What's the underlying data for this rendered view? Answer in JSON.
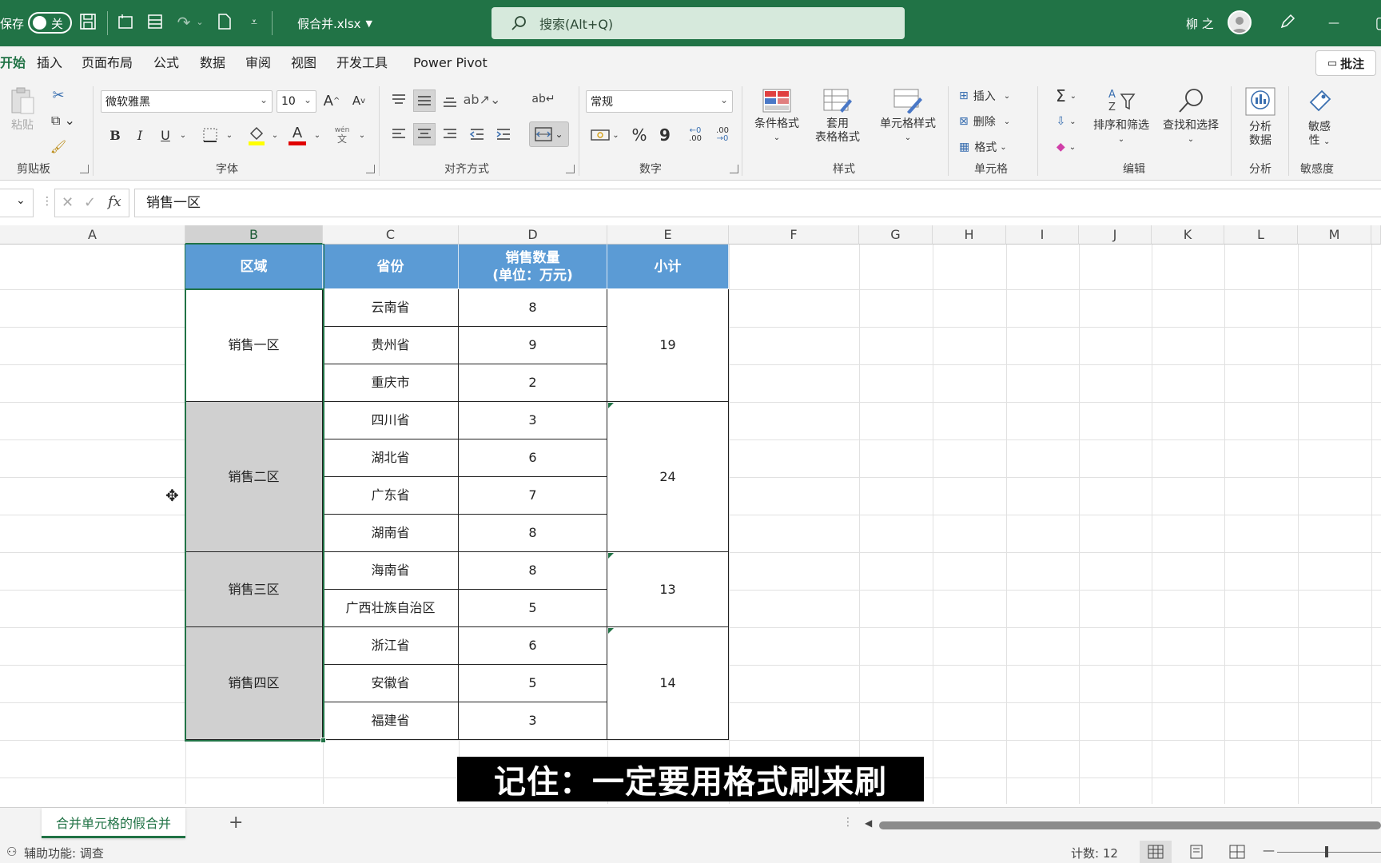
{
  "titlebar": {
    "autosave_label": "保存",
    "autosave_state": "关",
    "filename": "假合并.xlsx",
    "search_placeholder": "搜索(Alt+Q)",
    "user_name": "柳 之",
    "minimize_glyph": "—",
    "background_color": "#217346"
  },
  "menu": {
    "tabs": [
      "开始",
      "插入",
      "页面布局",
      "公式",
      "数据",
      "审阅",
      "视图",
      "开发工具",
      "Power Pivot"
    ],
    "active_tab": "开始",
    "comment_button": "批注"
  },
  "ribbon": {
    "clipboard": {
      "paste": "粘贴",
      "group": "剪贴板"
    },
    "font": {
      "name": "微软雅黑",
      "size": "10",
      "bold": "B",
      "italic": "I",
      "underline": "U",
      "phonetic": "wén",
      "phonetic2": "文",
      "group": "字体",
      "grow": "A",
      "shrink": "A",
      "font_color_glyph": "A"
    },
    "alignment": {
      "group": "对齐方式"
    },
    "number": {
      "format": "常规",
      "percent": "%",
      "comma": "9",
      "inc_decimal": ".00",
      "dec_decimal": ".00",
      "group": "数字"
    },
    "styles": {
      "conditional": "条件格式",
      "table_format_1": "套用",
      "table_format_2": "表格格式",
      "cell_styles": "单元格样式",
      "group": "样式"
    },
    "cells": {
      "insert": "插入",
      "delete": "删除",
      "format": "格式",
      "group": "单元格"
    },
    "editing": {
      "sort_filter": "排序和筛选",
      "find_select": "查找和选择",
      "group": "编辑",
      "sum_glyph": "Σ"
    },
    "analysis": {
      "analyze_1": "分析",
      "analyze_2": "数据",
      "group": "分析"
    },
    "sensitivity": {
      "label_1": "敏感",
      "label_2": "性",
      "group": "敏感度"
    }
  },
  "formula_bar": {
    "content": "销售一区",
    "fx": "fx"
  },
  "columns": [
    "A",
    "B",
    "C",
    "D",
    "E",
    "F",
    "G",
    "H",
    "I",
    "J",
    "K",
    "L",
    "M"
  ],
  "selected_column": "B",
  "table": {
    "headers": [
      "区域",
      "省份",
      "销售数量",
      "(单位：万元)",
      "小计"
    ],
    "regions": [
      "销售一区",
      "销售二区",
      "销售三区",
      "销售四区"
    ],
    "provinces": [
      "云南省",
      "贵州省",
      "重庆市",
      "四川省",
      "湖北省",
      "广东省",
      "湖南省",
      "海南省",
      "广西壮族自治区",
      "浙江省",
      "安徽省",
      "福建省"
    ],
    "quantities": [
      "8",
      "9",
      "2",
      "3",
      "6",
      "7",
      "8",
      "8",
      "5",
      "6",
      "5",
      "3"
    ],
    "subtotals": [
      "19",
      "24",
      "13",
      "14"
    ],
    "header_color": "#5b9bd5"
  },
  "subtitle": "记住：一定要用格式刷来刷",
  "sheets": {
    "active": "合并单元格的假合并",
    "add": "+"
  },
  "status": {
    "accessibility": "辅助功能: 调查",
    "count": "计数: 12",
    "zoom_minus": "—"
  }
}
